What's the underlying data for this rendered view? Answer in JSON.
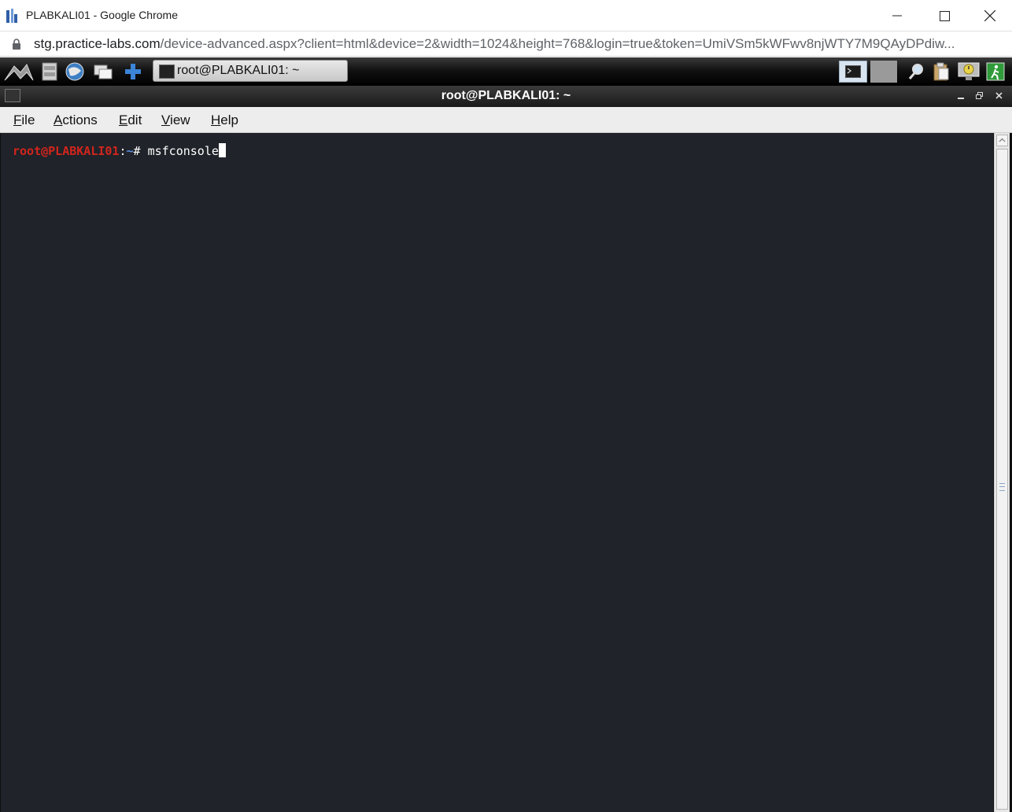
{
  "browser": {
    "window_title": "PLABKALI01 - Google Chrome",
    "url_host": "stg.practice-labs.com",
    "url_path": "/device-advanced.aspx?client=html&device=2&width=1024&height=768&login=true&token=UmiVSm5kWFwv8njWTY7M9QAyDPdiw..."
  },
  "taskbar": {
    "active_task_label": "root@PLABKALI01: ~"
  },
  "terminal": {
    "title": "root@PLABKALI01: ~",
    "menu": [
      {
        "underline": "F",
        "rest": "ile"
      },
      {
        "underline": "A",
        "rest": "ctions"
      },
      {
        "underline": "E",
        "rest": "dit"
      },
      {
        "underline": "V",
        "rest": "iew"
      },
      {
        "underline": "H",
        "rest": "elp"
      }
    ],
    "prompt_user_host": "root@PLABKALI01",
    "prompt_colon": ":",
    "prompt_path": "~",
    "prompt_symbol": "# ",
    "command": "msfconsole"
  },
  "colors": {
    "terminal_bg": "#202329",
    "prompt_user": "#d2251d",
    "prompt_path": "#5b8fe3"
  }
}
